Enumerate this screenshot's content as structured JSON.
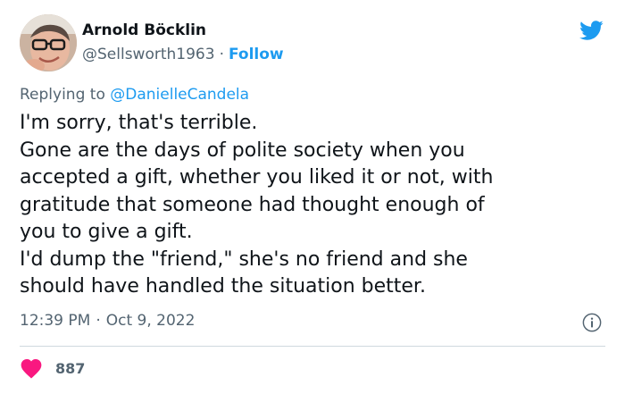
{
  "author": {
    "name": "Arnold Böcklin",
    "handle": "@Sellsworth1963",
    "separator": "·",
    "follow_label": "Follow"
  },
  "reply": {
    "prefix": "Replying to",
    "mention": "@DanielleCandela"
  },
  "tweet": {
    "lines": [
      "I'm sorry, that's terrible.",
      "Gone are the days of polite society when you",
      "accepted a gift, whether you liked it or not, with",
      "gratitude that someone had thought enough of",
      "you to give a gift.",
      "I'd dump the \"friend,\" she's no friend and she",
      "should have handled the situation better."
    ]
  },
  "meta": {
    "time": "12:39 PM",
    "separator": "·",
    "date": "Oct 9, 2022"
  },
  "engagement": {
    "like_count": "887"
  },
  "icons": {
    "brand": "twitter-bird-icon",
    "info": "info-icon",
    "like": "heart-icon"
  },
  "colors": {
    "accent": "#1d9bf0",
    "text": "#0f1419",
    "secondary_text": "#536471",
    "divider": "#cfd9de",
    "heart": "#f91880"
  }
}
